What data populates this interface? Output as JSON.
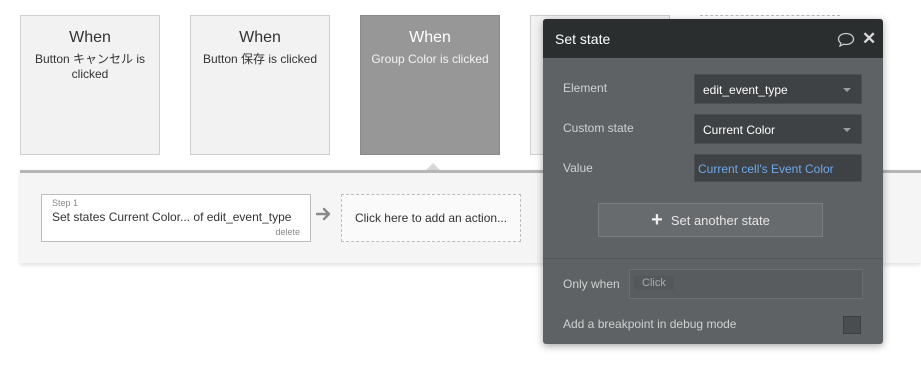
{
  "events": [
    {
      "when": "When",
      "desc": "Button キャンセル is clicked"
    },
    {
      "when": "When",
      "desc": "Button 保存 is clicked"
    },
    {
      "when": "When",
      "desc": "Group Color is clicked"
    },
    {
      "when": "",
      "desc": ""
    }
  ],
  "workflow": {
    "step": {
      "number": "Step 1",
      "text": "Set states Current Color... of edit_event_type",
      "delete": "delete"
    },
    "add_action": "Click here to add an action..."
  },
  "panel": {
    "title": "Set state",
    "element_label": "Element",
    "element_value": "edit_event_type",
    "custom_state_label": "Custom state",
    "custom_state_value": "Current Color",
    "value_label": "Value",
    "value_expression": "Current cell's Event Color",
    "add_state_label": "Set another state",
    "only_when_label": "Only when",
    "only_when_chip": "Click",
    "breakpoint_label": "Add a breakpoint in debug mode"
  },
  "icons": {
    "comment": "comment-icon",
    "close": "close-icon",
    "arrow": "arrow-right-icon",
    "plus": "plus-icon",
    "chevron": "chevron-down-icon"
  },
  "colors": {
    "selected_event": "#979797",
    "panel_bg": "#5f6264",
    "panel_header": "#2b2e2f",
    "expression_link": "#6ea8ea"
  }
}
